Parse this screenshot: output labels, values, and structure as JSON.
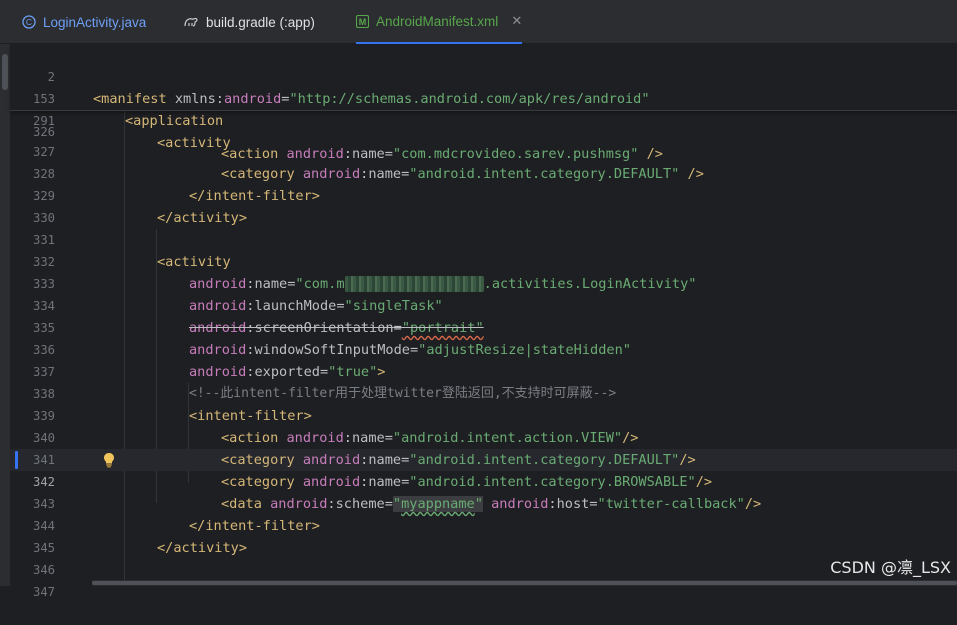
{
  "tabs": [
    {
      "label": "LoginActivity.java",
      "icon": "java-class-icon",
      "color": "#6ea0f6",
      "active": false
    },
    {
      "label": "build.gradle (:app)",
      "icon": "gradle-icon",
      "color": "#c9ccd1",
      "active": false
    },
    {
      "label": "AndroidManifest.xml",
      "icon": "manifest-icon",
      "color": "#57a64a",
      "active": true,
      "close": "✕"
    }
  ],
  "sticky_lines": [
    {
      "num": "2",
      "code": "<manifest xmlns:android=\"http://schemas.android.com/apk/res/android\""
    },
    {
      "num": "153",
      "code": "<application"
    },
    {
      "num": "291",
      "code": "<activity"
    }
  ],
  "lines": [
    {
      "num": "326",
      "code": "<action android:name=\"com.mdcrovideo.sarev.pushmsg\" />"
    },
    {
      "num": "327",
      "code": "<category android:name=\"android.intent.category.DEFAULT\" />"
    },
    {
      "num": "328",
      "code": "</intent-filter>"
    },
    {
      "num": "329",
      "code": "</activity>"
    },
    {
      "num": "330",
      "code": ""
    },
    {
      "num": "331",
      "code": "<activity"
    },
    {
      "num": "332",
      "code": "android:name=\"com.m.activities.LoginActivity\""
    },
    {
      "num": "333",
      "code": "android:launchMode=\"singleTask\""
    },
    {
      "num": "334",
      "code": "android:screenOrientation=\"portrait\""
    },
    {
      "num": "335",
      "code": "android:windowSoftInputMode=\"adjustResize|stateHidden\""
    },
    {
      "num": "336",
      "code": "android:exported=\"true\">"
    },
    {
      "num": "337",
      "code": "<!--此intent-filter用于处理twitter登陆返回,不支持时可屏蔽-->"
    },
    {
      "num": "338",
      "code": "<intent-filter>"
    },
    {
      "num": "339",
      "code": "<action android:name=\"android.intent.action.VIEW\"/>"
    },
    {
      "num": "340",
      "code": "<category android:name=\"android.intent.category.DEFAULT\"/>"
    },
    {
      "num": "341",
      "code": "<category android:name=\"android.intent.category.BROWSABLE\"/>"
    },
    {
      "num": "342",
      "code": "<data android:scheme=\"myappname\" android:host=\"twitter-callback\"/>"
    },
    {
      "num": "343",
      "code": "</intent-filter>"
    },
    {
      "num": "344",
      "code": "</activity>"
    },
    {
      "num": "345",
      "code": ""
    },
    {
      "num": "346",
      "code": ""
    },
    {
      "num": "347",
      "code": ""
    }
  ],
  "current_line": "342",
  "watermark": "CSDN @凛_LSX",
  "colors": {
    "tag": "#d5b778",
    "namespace": "#c77dbb",
    "string": "#6aab73",
    "comment": "#7a7e85",
    "accent": "#3574f0"
  }
}
